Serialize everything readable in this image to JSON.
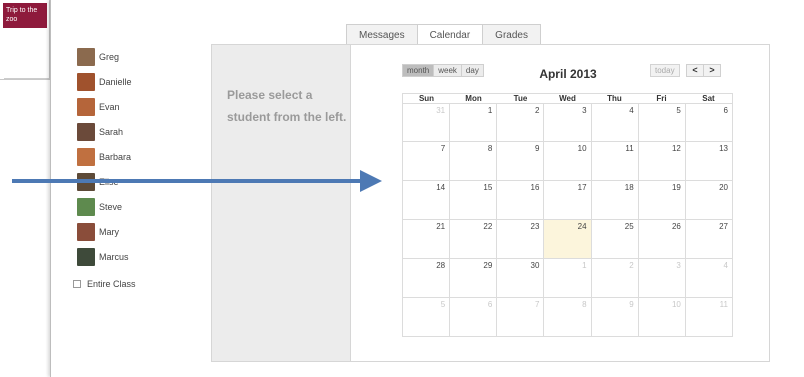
{
  "background_event": {
    "label": "Trip to the zoo"
  },
  "tabs": [
    {
      "label": "Messages",
      "active": false
    },
    {
      "label": "Calendar",
      "active": true
    },
    {
      "label": "Grades",
      "active": false
    }
  ],
  "students": [
    {
      "name": "Greg",
      "avatar_color": "#8b6a4e"
    },
    {
      "name": "Danielle",
      "avatar_color": "#a0522d"
    },
    {
      "name": "Evan",
      "avatar_color": "#b5653a"
    },
    {
      "name": "Sarah",
      "avatar_color": "#6b4a3a"
    },
    {
      "name": "Barbara",
      "avatar_color": "#c07040"
    },
    {
      "name": "Elise",
      "avatar_color": "#5d4a38"
    },
    {
      "name": "Steve",
      "avatar_color": "#5e8a4e"
    },
    {
      "name": "Mary",
      "avatar_color": "#8a4d3a"
    },
    {
      "name": "Marcus",
      "avatar_color": "#3e4a3a"
    }
  ],
  "entire_class": {
    "label": "Entire Class",
    "checked": false
  },
  "prompt": "Please select a student from the left.",
  "calendar": {
    "view_buttons": [
      {
        "label": "month",
        "active": true
      },
      {
        "label": "week",
        "active": false
      },
      {
        "label": "day",
        "active": false
      }
    ],
    "title": "April 2013",
    "today_label": "today",
    "prev_label": "<",
    "next_label": ">",
    "day_headers": [
      "Sun",
      "Mon",
      "Tue",
      "Wed",
      "Thu",
      "Fri",
      "Sat"
    ],
    "weeks": [
      [
        {
          "d": "31",
          "other": true
        },
        {
          "d": "1"
        },
        {
          "d": "2"
        },
        {
          "d": "3"
        },
        {
          "d": "4"
        },
        {
          "d": "5"
        },
        {
          "d": "6"
        }
      ],
      [
        {
          "d": "7"
        },
        {
          "d": "8"
        },
        {
          "d": "9"
        },
        {
          "d": "10"
        },
        {
          "d": "11"
        },
        {
          "d": "12"
        },
        {
          "d": "13"
        }
      ],
      [
        {
          "d": "14"
        },
        {
          "d": "15"
        },
        {
          "d": "16"
        },
        {
          "d": "17"
        },
        {
          "d": "18"
        },
        {
          "d": "19"
        },
        {
          "d": "20"
        }
      ],
      [
        {
          "d": "21"
        },
        {
          "d": "22"
        },
        {
          "d": "23"
        },
        {
          "d": "24",
          "today": true
        },
        {
          "d": "25"
        },
        {
          "d": "26"
        },
        {
          "d": "27"
        }
      ],
      [
        {
          "d": "28"
        },
        {
          "d": "29"
        },
        {
          "d": "30"
        },
        {
          "d": "1",
          "other": true
        },
        {
          "d": "2",
          "other": true
        },
        {
          "d": "3",
          "other": true
        },
        {
          "d": "4",
          "other": true
        }
      ],
      [
        {
          "d": "5",
          "other": true
        },
        {
          "d": "6",
          "other": true
        },
        {
          "d": "7",
          "other": true
        },
        {
          "d": "8",
          "other": true
        },
        {
          "d": "9",
          "other": true
        },
        {
          "d": "10",
          "other": true
        },
        {
          "d": "11",
          "other": true
        }
      ]
    ]
  },
  "colors": {
    "accent_tab": "#4caf3a",
    "arrow": "#4d79b4",
    "event_bg": "#8e1a3c",
    "today_bg": "#fcf5dc"
  }
}
